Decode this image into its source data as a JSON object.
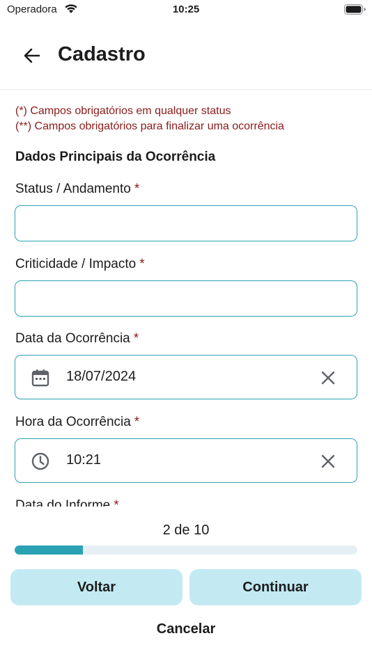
{
  "status_bar": {
    "carrier": "Operadora",
    "time": "10:25"
  },
  "header": {
    "title": "Cadastro",
    "back_icon": "arrow-left-icon"
  },
  "notes": {
    "line1": "(*) Campos obrigatórios em qualquer status",
    "line2": "(**) Campos obrigatórios para finalizar uma ocorrência",
    "color": "#8b1a1a"
  },
  "section_title": "Dados Principais da Ocorrência",
  "fields": {
    "status": {
      "label": "Status / Andamento",
      "required_mark": "*",
      "value": ""
    },
    "criticidade": {
      "label": "Criticidade / Impacto",
      "required_mark": "*",
      "value": ""
    },
    "data_ocorrencia": {
      "label": "Data da Ocorrência",
      "required_mark": "*",
      "value": "18/07/2024",
      "icon": "calendar-icon"
    },
    "hora_ocorrencia": {
      "label": "Hora da Ocorrência",
      "required_mark": "*",
      "value": "10:21",
      "icon": "clock-icon"
    },
    "data_informe": {
      "label": "Data do Informe",
      "required_mark": "*"
    }
  },
  "progress": {
    "text": "2 de 10",
    "current": 2,
    "total": 10,
    "fraction": 0.2,
    "color": "#2aa2b4"
  },
  "buttons": {
    "back": "Voltar",
    "next": "Continuar",
    "cancel": "Cancelar"
  },
  "colors": {
    "accent": "#2aa2b4",
    "button_bg": "#c3eaf3"
  }
}
